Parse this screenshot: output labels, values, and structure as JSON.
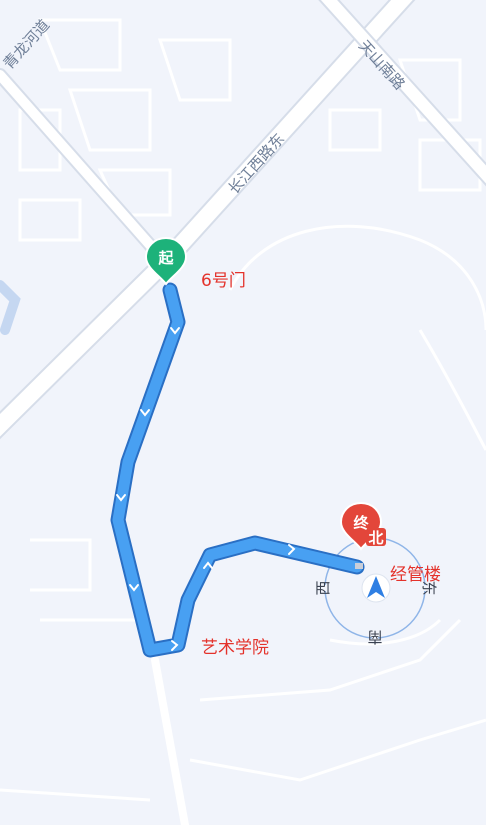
{
  "map": {
    "colors": {
      "background": "#f1f4fb",
      "roads": "#ffffff",
      "road_outline": "#d6dde9",
      "route": "#3d8fe9",
      "route_outline": "#2a6fc4",
      "start_pin": "#1db27a",
      "end_pin": "#e3463a",
      "poi_text": "#e4322b",
      "compass_ring": "#8fb5e8"
    },
    "road_labels": [
      {
        "id": "qinglong",
        "text": "青龙河道"
      },
      {
        "id": "tianshan",
        "text": "天山南路"
      },
      {
        "id": "changjiang_east",
        "text": "长江西路东"
      }
    ],
    "start_marker": {
      "text": "起",
      "icon": "start-pin-icon"
    },
    "end_marker": {
      "text": "终",
      "icon": "end-pin-icon"
    },
    "poi_labels": {
      "gate6": "6号门",
      "jingguan": "经管楼",
      "yishu": "艺术学院"
    },
    "compass": {
      "north": "北",
      "east": "东",
      "south": "南",
      "west": "西",
      "icon": "navigation-arrow-icon"
    }
  }
}
